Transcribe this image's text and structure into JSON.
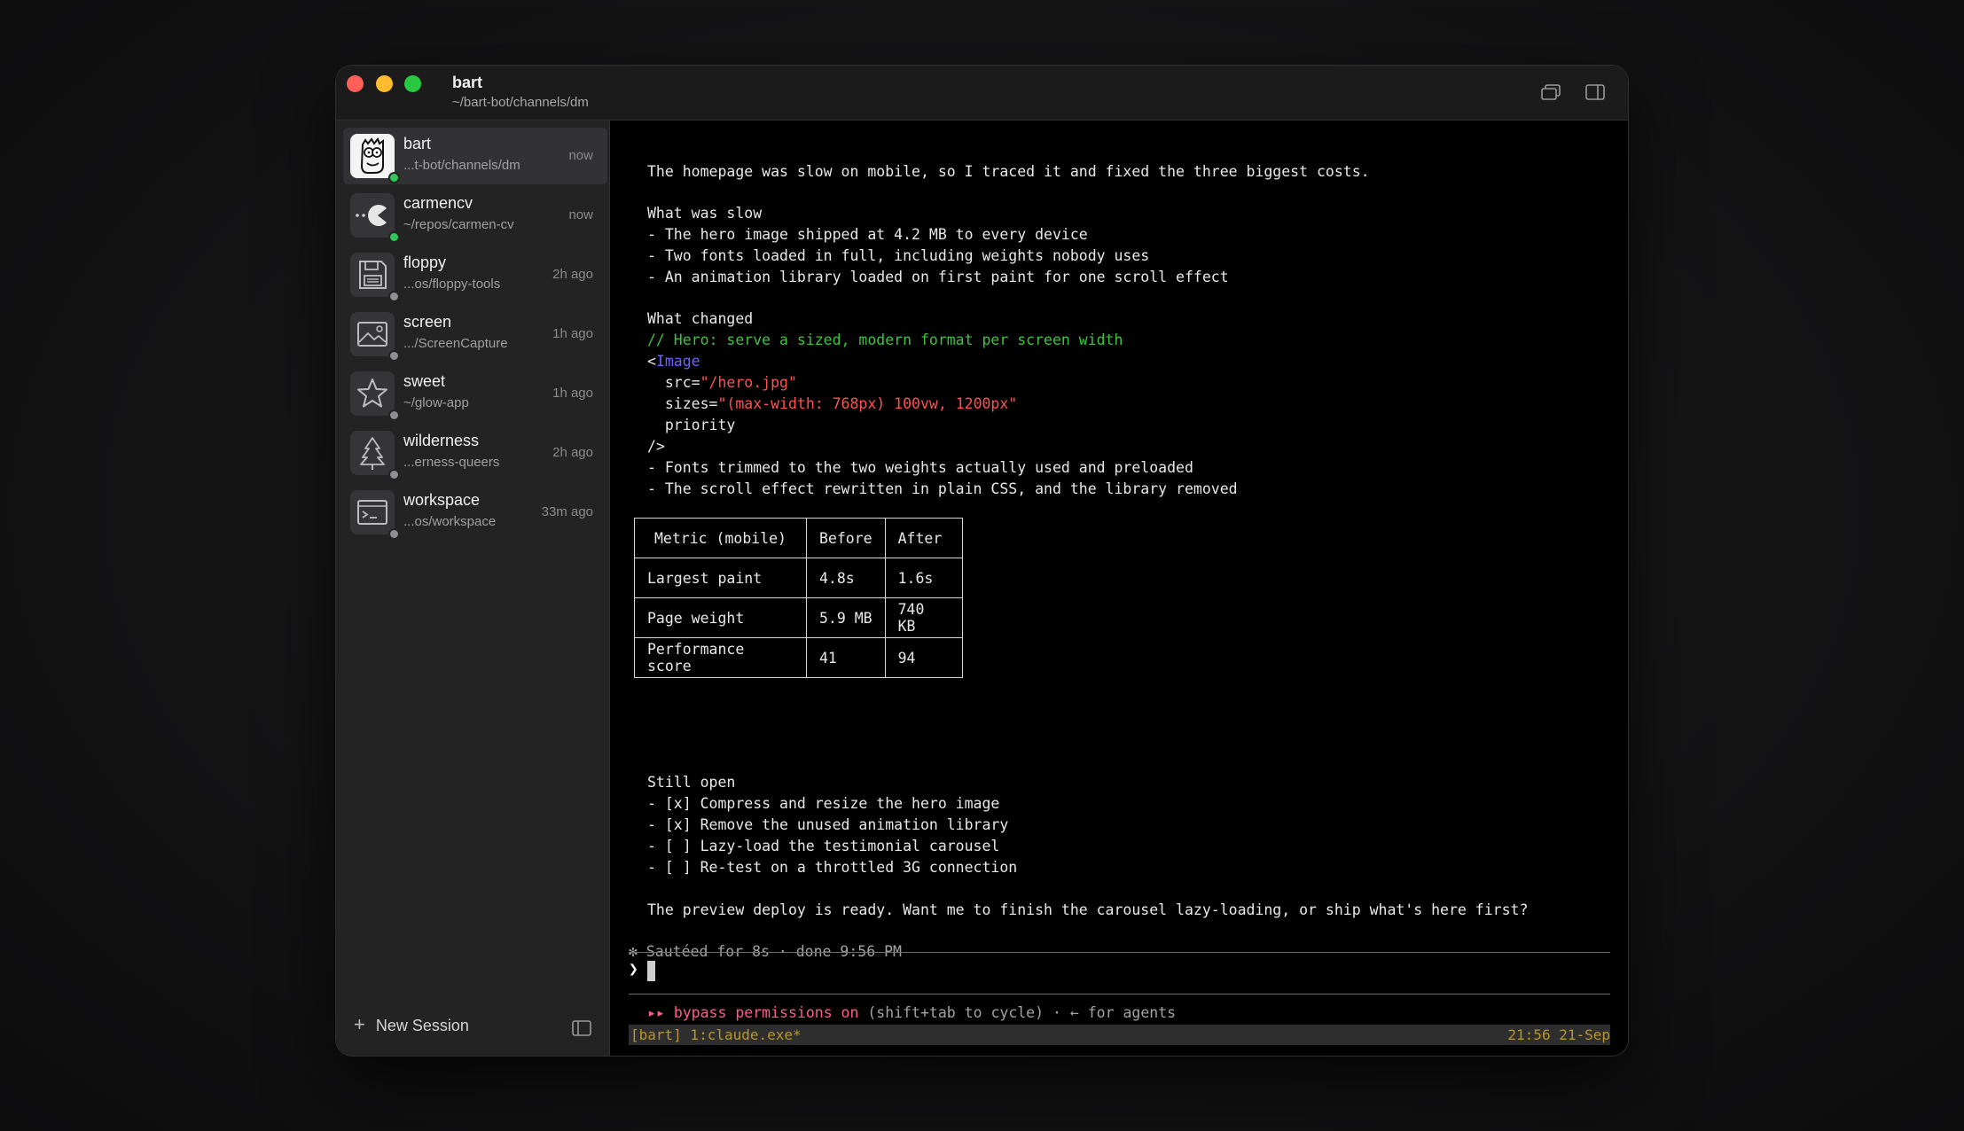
{
  "window": {
    "title": "bart",
    "subtitle": "~/bart-bot/channels/dm"
  },
  "sessions": [
    {
      "name": "bart",
      "path": "...t-bot/channels/dm",
      "time": "now",
      "active": true,
      "status": "online",
      "icon": "cartoon-face-icon"
    },
    {
      "name": "carmencv",
      "path": "~/repos/carmen-cv",
      "time": "now",
      "active": false,
      "status": "online",
      "icon": "pacman-icon"
    },
    {
      "name": "floppy",
      "path": "...os/floppy-tools",
      "time": "2h ago",
      "active": false,
      "status": "idle",
      "icon": "floppy-disk-icon"
    },
    {
      "name": "screen",
      "path": ".../ScreenCapture",
      "time": "1h ago",
      "active": false,
      "status": "idle",
      "icon": "landscape-icon"
    },
    {
      "name": "sweet",
      "path": "~/glow-app",
      "time": "1h ago",
      "active": false,
      "status": "idle",
      "icon": "star-icon"
    },
    {
      "name": "wilderness",
      "path": "...erness-queers",
      "time": "2h ago",
      "active": false,
      "status": "idle",
      "icon": "tree-icon"
    },
    {
      "name": "workspace",
      "path": "...os/workspace",
      "time": "33m ago",
      "active": false,
      "status": "idle",
      "icon": "terminal-window-icon"
    }
  ],
  "footer": {
    "new_session": "New Session"
  },
  "colors": {
    "online": "#32c759",
    "idle": "#8e8e93",
    "comment": "#3ec23e",
    "tag": "#6b62ff",
    "string": "#ff5151",
    "bypass": "#ff5c8a",
    "status_text": "#b8962e"
  },
  "terminal": {
    "intro": "The homepage was slow on mobile, so I traced it and fixed the three biggest costs.",
    "slow_heading": "What was slow",
    "slow_items": [
      "- The hero image shipped at 4.2 MB to every device",
      "- Two fonts loaded in full, including weights nobody uses",
      "- An animation library loaded on first paint for one scroll effect"
    ],
    "changed_heading": "What changed",
    "code": {
      "comment": "// Hero: serve a sized, modern format per screen width",
      "open": "<",
      "tag": "Image",
      "src_attr": "  src=",
      "src_val": "\"/hero.jpg\"",
      "sizes_attr": "  sizes=",
      "sizes_val": "\"(max-width: 768px) 100vw, 1200px\"",
      "priority": "  priority",
      "close": "/>"
    },
    "changed_items": [
      "- Fonts trimmed to the two weights actually used and preloaded",
      "- The scroll effect rewritten in plain CSS, and the library removed"
    ],
    "table": {
      "headers": [
        "Metric (mobile)",
        "Before",
        "After"
      ],
      "rows": [
        [
          "Largest paint",
          "4.8s",
          "1.6s"
        ],
        [
          "Page weight",
          "5.9 MB",
          "740 KB"
        ],
        [
          "Performance score",
          "41",
          "94"
        ]
      ]
    },
    "open_heading": "Still open",
    "open_items": [
      "- [x] Compress and resize the hero image",
      "- [x] Remove the unused animation library",
      "- [ ] Lazy-load the testimonial carousel",
      "- [ ] Re-test on a throttled 3G connection"
    ],
    "question": "The preview deploy is ready. Want me to finish the carousel lazy-loading, or ship what's here first?",
    "done_line": "✻ Sautéed for 8s · done 9:56 PM",
    "prompt_symbol": "❯",
    "bypass_arrows": "▸▸",
    "bypass_label": "bypass permissions on",
    "bypass_hint": "(shift+tab to cycle) · ← for agents",
    "status_left": "[bart] 1:claude.exe*",
    "status_right": "21:56 21-Sep"
  }
}
